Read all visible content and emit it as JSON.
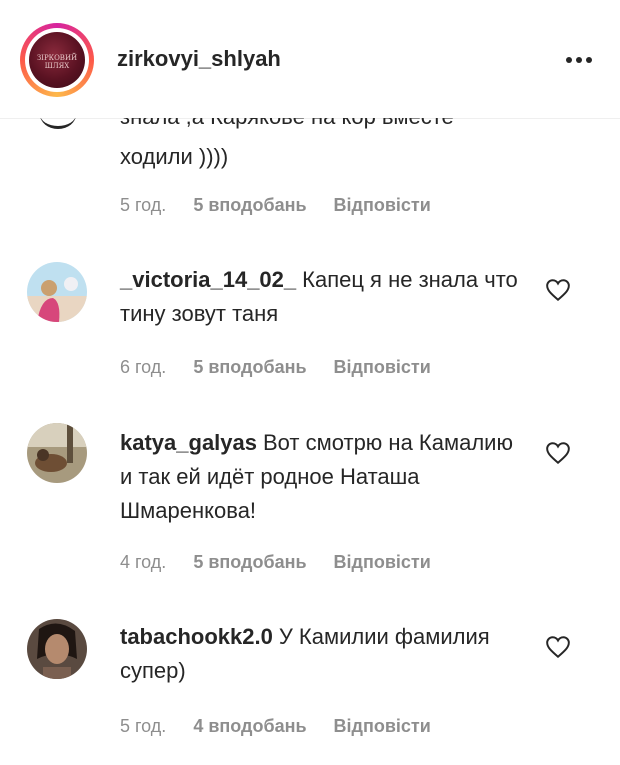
{
  "header": {
    "username": "zirkovyi_shlyah",
    "logo_text": "ЗІРКОВИЙ\nШЛЯХ"
  },
  "partial_comment": {
    "clipped_text": "знала ,а Карякове на кор вместе",
    "text_end": "ходили ))))",
    "time": "5 год.",
    "likes": "5 вподобань",
    "reply": "Відповісти"
  },
  "comments": [
    {
      "username": "_victoria_14_02_",
      "text": "Капец я не знала что тину зовут таня",
      "time": "6 год.",
      "likes": "5 вподобань",
      "reply": "Відповісти"
    },
    {
      "username": "katya_galyas",
      "text": "Вот смотрю на Камалию и так ей идёт родное Наташа Шмаренкова!",
      "time": "4 год.",
      "likes": "5 вподобань",
      "reply": "Відповісти"
    },
    {
      "username": "tabachookk2.0",
      "text": "У Камилии фамилия супер)",
      "time": "5 год.",
      "likes": "4 вподобань",
      "reply": "Відповісти"
    }
  ],
  "icons": {
    "more": "more-options-icon",
    "like": "heart-outline-icon"
  },
  "colors": {
    "text": "#262626",
    "muted": "#8e8e8e",
    "ring_start": "#d6249f",
    "ring_end": "#fdb84a"
  }
}
